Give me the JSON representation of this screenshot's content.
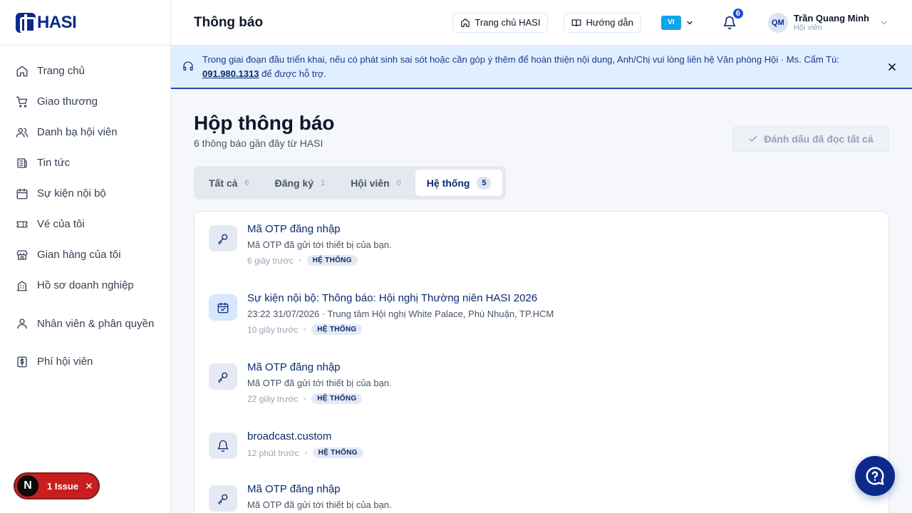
{
  "logo": {
    "text": "HASI"
  },
  "sidebar": {
    "items": [
      {
        "label": "Trang chủ",
        "icon": "home-icon"
      },
      {
        "label": "Giao thương",
        "icon": "cart-icon"
      },
      {
        "label": "Danh bạ hội viên",
        "icon": "users-icon"
      },
      {
        "label": "Tin tức",
        "icon": "news-icon"
      },
      {
        "label": "Sự kiện nội bộ",
        "icon": "calendar-icon"
      },
      {
        "label": "Vé của tôi",
        "icon": "ticket-icon"
      },
      {
        "label": "Gian hàng của tôi",
        "icon": "store-icon"
      },
      {
        "label": "Hồ sơ doanh nghiệp",
        "icon": "building-icon"
      },
      {
        "label": "Nhân viên & phân quyền",
        "icon": "person-icon"
      },
      {
        "label": "Phí hội viên",
        "icon": "dollar-icon"
      }
    ]
  },
  "header": {
    "title": "Thông báo",
    "home_button": "Trang chủ HASI",
    "guide_button": "Hướng dẫn",
    "lang": "VI",
    "notification_count": "6",
    "user": {
      "initials": "QM",
      "name": "Trần Quang Minh",
      "role": "Hội viên"
    }
  },
  "banner": {
    "text": "Trong giai đoạn đầu triển khai, nếu có phát sinh sai sót hoặc cần góp ý thêm để hoàn thiện nội dung, Anh/Chị vui lòng liên hệ Văn phòng Hội · Ms. Cẩm Tú: ",
    "phone": "091.980.1313",
    "suffix": " để được hỗ trợ."
  },
  "main": {
    "heading": "Hộp thông báo",
    "subtitle": "6 thông báo gần đây từ HASI",
    "mark_all": "Đánh dấu đã đọc tất cả",
    "tabs": [
      {
        "label": "Tất cả",
        "count": "6"
      },
      {
        "label": "Đăng ký",
        "count": "1"
      },
      {
        "label": "Hội viên",
        "count": "0"
      },
      {
        "label": "Hệ thống",
        "count": "5"
      }
    ],
    "notifications": [
      {
        "title": "Mã OTP đăng nhập",
        "desc": "Mã OTP đã gửi tới thiết bị của bạn.",
        "time": "6 giây trước",
        "tag": "HỆ THỐNG",
        "icon": "key-icon"
      },
      {
        "title": "Sự kiện nội bộ: Thông báo: Hội nghị Thường niên HASI 2026",
        "desc": "23:22 31/07/2026 · Trung tâm Hội nghị White Palace, Phú Nhuận, TP.HCM",
        "time": "10 giây trước",
        "tag": "HỆ THỐNG",
        "icon": "calendar-check-icon"
      },
      {
        "title": "Mã OTP đăng nhập",
        "desc": "Mã OTP đã gửi tới thiết bị của bạn.",
        "time": "22 giây trước",
        "tag": "HỆ THỐNG",
        "icon": "key-icon"
      },
      {
        "title": "broadcast.custom",
        "desc": "",
        "time": "12 phút trước",
        "tag": "HỆ THỐNG",
        "icon": "bell-icon"
      },
      {
        "title": "Mã OTP đăng nhập",
        "desc": "Mã OTP đã gửi tới thiết bị của bạn.",
        "time": "",
        "tag": "",
        "icon": "key-icon"
      }
    ]
  },
  "issue_badge": {
    "letter": "N",
    "label": "1 Issue"
  },
  "colors": {
    "brand": "#0b2a8a",
    "accent": "#0ea5e9",
    "danger": "#c81e1e"
  }
}
